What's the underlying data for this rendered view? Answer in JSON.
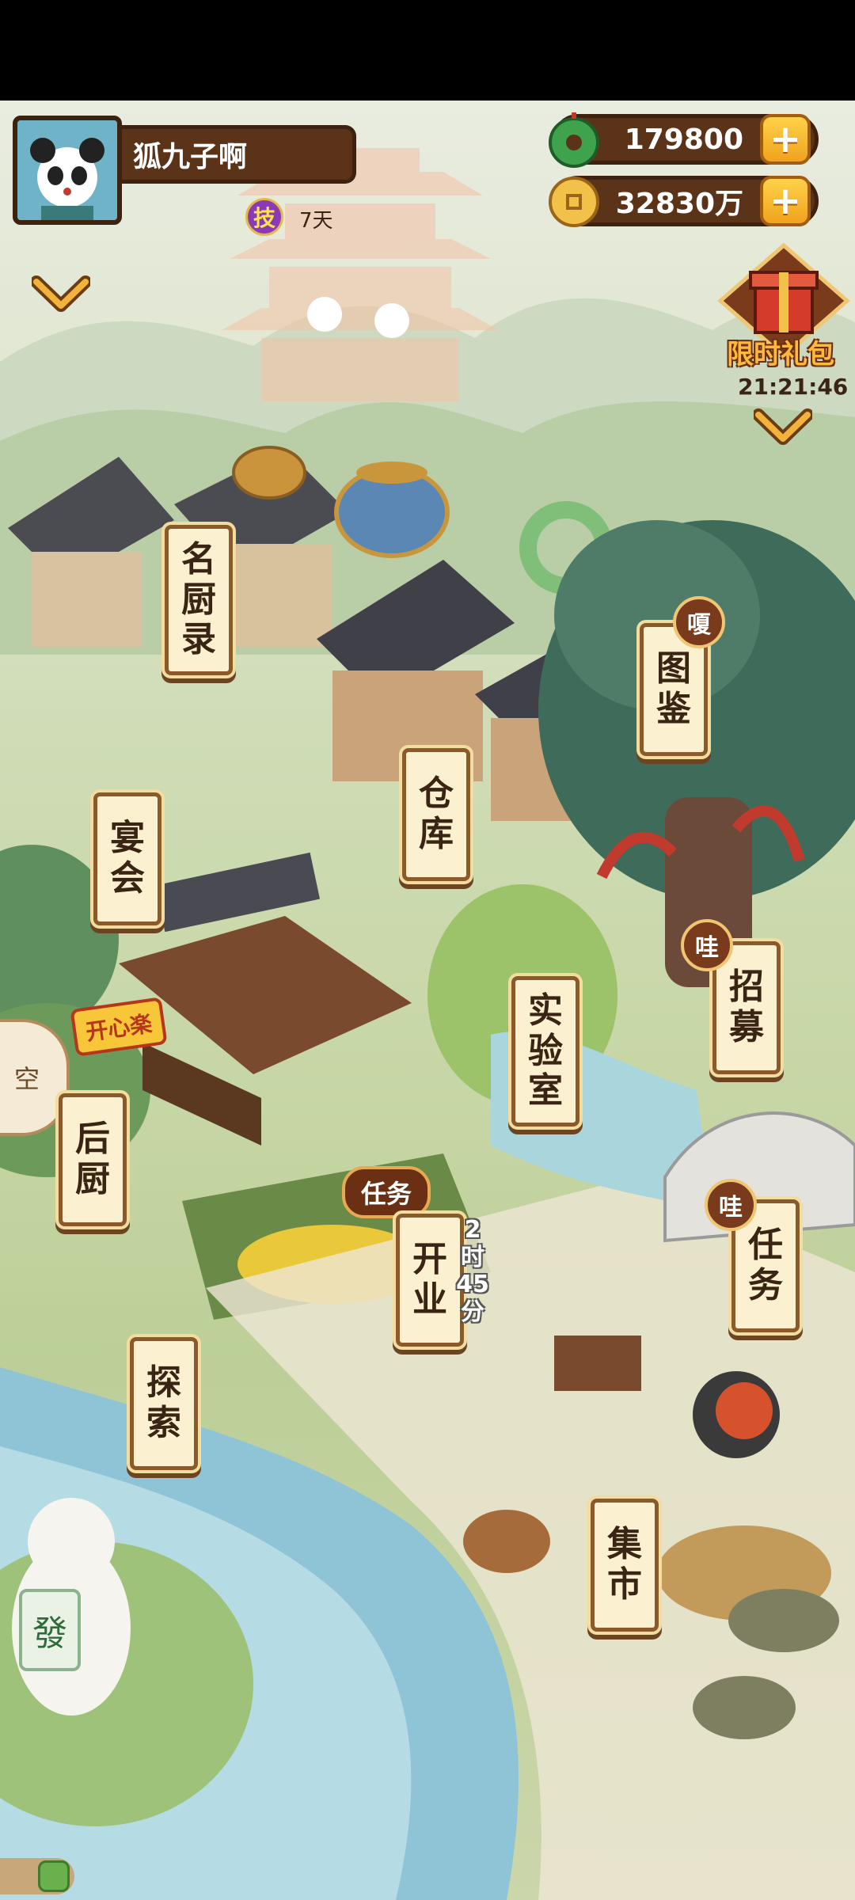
{
  "player": {
    "name": "狐九子啊",
    "skill_badge": "技",
    "skill_days": "7天"
  },
  "resources": {
    "jade": "179800",
    "coins": "32830万"
  },
  "gift": {
    "title": "限时礼包",
    "timer": "21:21:46"
  },
  "buildings": {
    "chef_list": [
      "名",
      "厨",
      "录"
    ],
    "atlas": [
      "图",
      "鉴"
    ],
    "atlas_badge": "嗄",
    "warehouse": [
      "仓",
      "库"
    ],
    "banquet": [
      "宴",
      "会"
    ],
    "recruit": [
      "招",
      "募"
    ],
    "recruit_badge": "哇",
    "lab": [
      "实",
      "验",
      "室"
    ],
    "kitchen": [
      "后",
      "厨"
    ],
    "open": [
      "开",
      "业"
    ],
    "open_timer": [
      "2",
      "时",
      "45",
      "分"
    ],
    "task_pill": "任务",
    "tasks": [
      "任",
      "务"
    ],
    "tasks_badge": "哇",
    "explore": [
      "探",
      "索"
    ],
    "market": [
      "集",
      "市"
    ]
  },
  "decor": {
    "shop_sign": "开心楽",
    "fan_char": "空",
    "mahjong_tile": "發"
  },
  "icons": [
    "jade-icon",
    "coin-icon",
    "plus-icon",
    "chevron-down-icon",
    "gift-box-icon",
    "avatar"
  ],
  "colors": {
    "frame_brown": "#8b5a2b",
    "sign_paper": "#fbf1d0",
    "gold": "#f0a21c",
    "water": "#8fc3d6"
  }
}
